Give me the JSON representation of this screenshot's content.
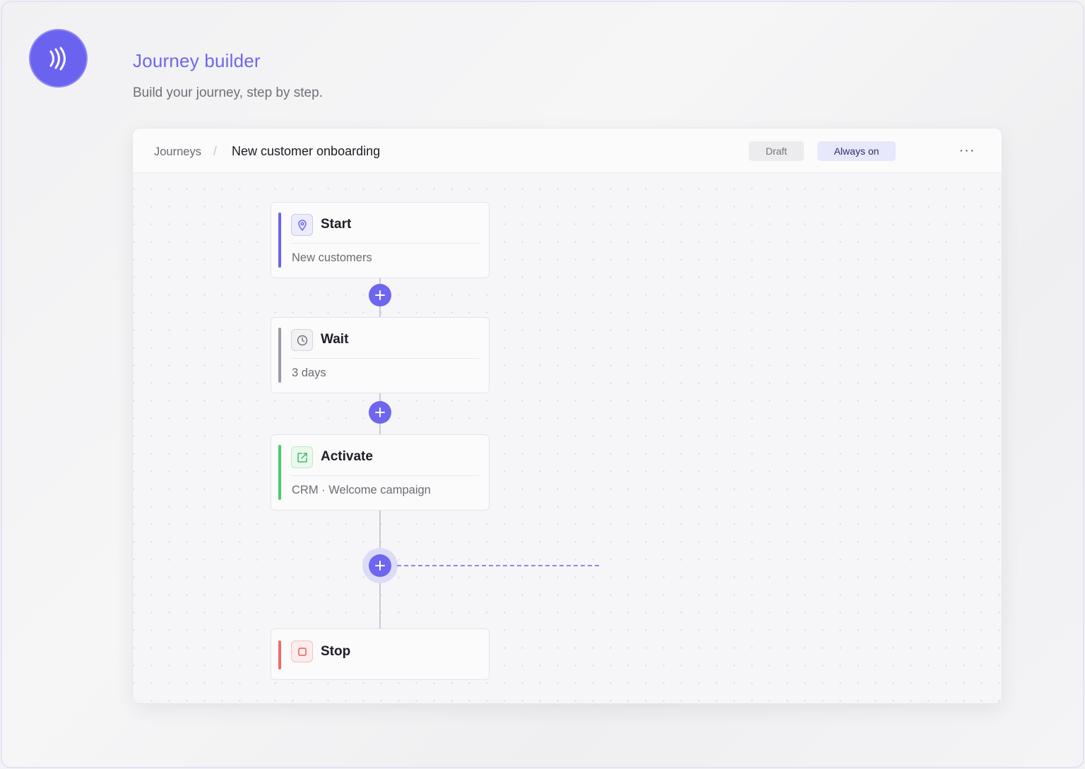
{
  "header": {
    "title": "Journey builder",
    "subtitle": "Build your journey, step by step."
  },
  "breadcrumb": {
    "root": "Journeys",
    "separator": "/",
    "current": "New customer onboarding"
  },
  "badges": {
    "draft": "Draft",
    "always_on": "Always on"
  },
  "menu": {
    "more": "···"
  },
  "steps": [
    {
      "title": "Start",
      "subtitle": "New customers",
      "icon": "map-pin-icon",
      "accent": "#6b63f0"
    },
    {
      "title": "Wait",
      "subtitle": "3 days",
      "icon": "clock-icon",
      "accent": "#9a9aa2"
    },
    {
      "title": "Activate",
      "subtitle": "CRM · Welcome campaign",
      "icon": "external-link-icon",
      "accent": "#4cc96e"
    },
    {
      "title": "Stop",
      "subtitle": "",
      "icon": "stop-square-icon",
      "accent": "#ef6a6a"
    }
  ],
  "add_buttons": [
    "plus-icon",
    "plus-icon",
    "plus-icon"
  ],
  "colors": {
    "brand": "#6e66ee",
    "start_accent": "#6b63f0",
    "wait_accent": "#9a9aa2",
    "activate_accent": "#4cc96e",
    "stop_accent": "#ef6a6a"
  }
}
